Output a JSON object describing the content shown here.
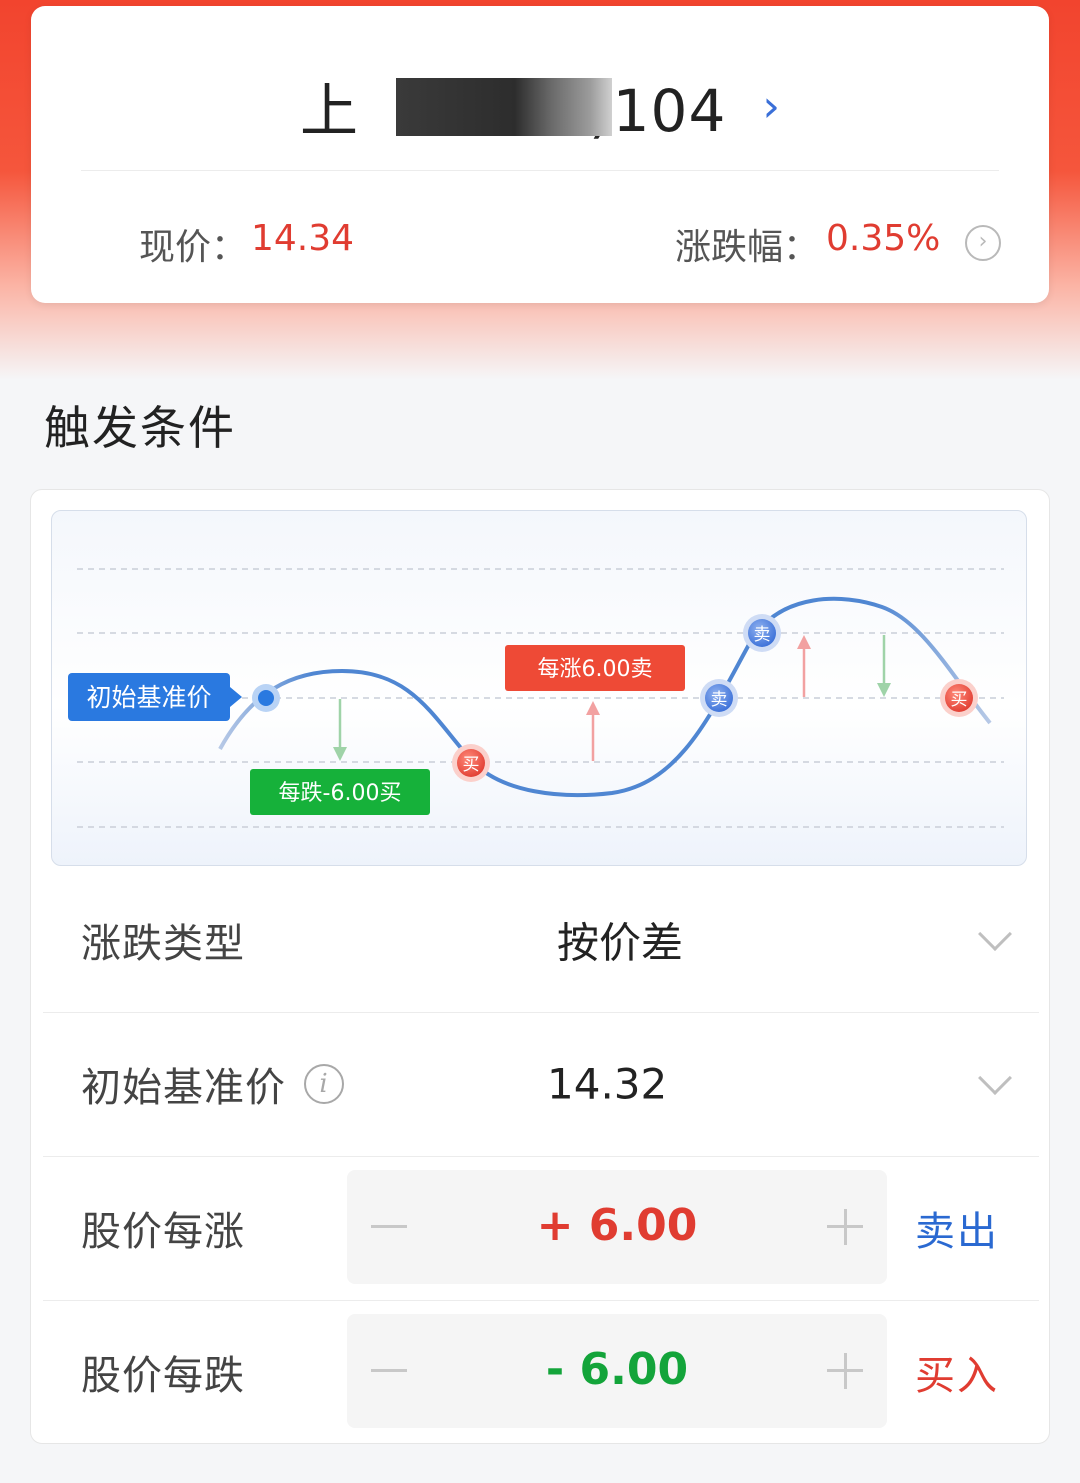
{
  "stock": {
    "name_prefix": "上",
    "name_suffix": ")104",
    "current_price_label": "现价：",
    "current_price": "14.34",
    "change_label": "涨跌幅：",
    "change_pct": "0.35%"
  },
  "section_title": "触发条件",
  "diagram": {
    "base_label": "初始基准价",
    "rise_label": "每涨6.00卖",
    "fall_label": "每跌-6.00买",
    "buy_marker": "买",
    "sell_marker": "卖"
  },
  "rows": {
    "type_label": "涨跌类型",
    "type_value": "按价差",
    "base_label": "初始基准价",
    "base_value": "14.32",
    "rise_label": "股价每涨",
    "rise_value": "+ 6.00",
    "rise_action": "卖出",
    "fall_label": "股价每跌",
    "fall_value": "- 6.00",
    "fall_action": "买入"
  },
  "colors": {
    "red": "#e03c31",
    "green": "#13a43a",
    "blue": "#2a69d1"
  }
}
